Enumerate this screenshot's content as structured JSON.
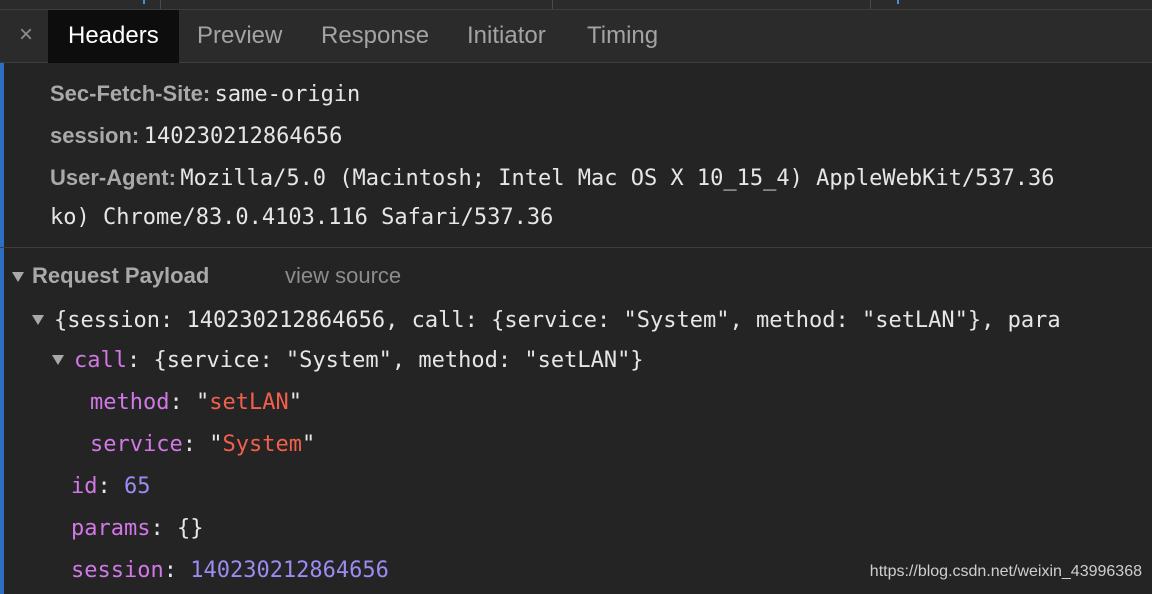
{
  "tabs": {
    "close": "×",
    "headers": "Headers",
    "preview": "Preview",
    "response": "Response",
    "initiator": "Initiator",
    "timing": "Timing"
  },
  "request_headers": [
    {
      "name": "Sec-Fetch-Site:",
      "value": "same-origin"
    },
    {
      "name": "session:",
      "value": "140230212864656"
    },
    {
      "name": "User-Agent:",
      "value": "Mozilla/5.0 (Macintosh; Intel Mac OS X 10_15_4) AppleWebKit/537.36"
    }
  ],
  "user_agent_continued": "ko) Chrome/83.0.4103.116 Safari/537.36",
  "payload": {
    "title": "Request Payload",
    "view_source": "view source",
    "summary": "{session: 140230212864656, call: {service: \"System\", method: \"setLAN\"}, para",
    "call_key": "call",
    "call_summary": "{service: \"System\", method: \"setLAN\"}",
    "method_key": "method",
    "method_value": "setLAN",
    "service_key": "service",
    "service_value": "System",
    "id_key": "id",
    "id_value": "65",
    "params_key": "params",
    "params_value": "{}",
    "session_key": "session",
    "session_value": "140230212864656"
  },
  "watermark": "https://blog.csdn.net/weixin_43996368",
  "colors": {
    "background": "#242424",
    "active_tab": "#0d0d0d",
    "accent": "#2d6fc0",
    "key": "#d177e6",
    "string": "#f1604d",
    "number": "#9a8cf2"
  }
}
